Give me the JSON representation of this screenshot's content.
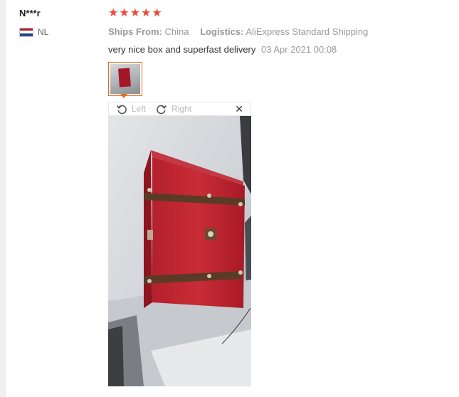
{
  "reviewer": {
    "name": "N***r",
    "country": "NL",
    "flag_colors": [
      "#ae1c28",
      "#ffffff",
      "#21468b"
    ]
  },
  "rating": {
    "stars": 5,
    "max": 5,
    "color": "#f0493c"
  },
  "shipping": {
    "ships_from_label": "Ships From:",
    "ships_from_value": "China",
    "logistics_label": "Logistics:",
    "logistics_value": "AliExpress Standard Shipping"
  },
  "review": {
    "text": "very nice box and superfast delivery",
    "date": "03 Apr 2021 00:08"
  },
  "viewer": {
    "rotate_left_label": "Left",
    "rotate_right_label": "Right",
    "close_icon": "close-icon",
    "accent": "#e46e1e"
  }
}
